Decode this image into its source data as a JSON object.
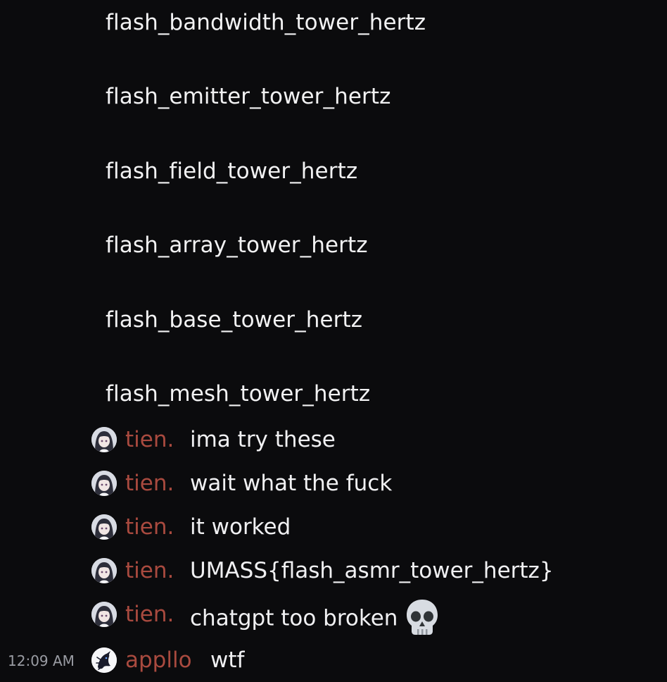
{
  "code_lines": [
    "flash_bandwidth_tower_hertz",
    "flash_emitter_tower_hertz",
    "flash_field_tower_hertz",
    "flash_array_tower_hertz",
    "flash_base_tower_hertz",
    "flash_mesh_tower_hertz"
  ],
  "messages": [
    {
      "author": "tien.",
      "text": "ima try these"
    },
    {
      "author": "tien.",
      "text": "wait what the fuck"
    },
    {
      "author": "tien.",
      "text": "it worked"
    },
    {
      "author": "tien.",
      "text": "UMASS{flash_asmr_tower_hertz}"
    },
    {
      "author": "tien.",
      "text": "chatgpt too broken",
      "emoji": "skull-icon"
    },
    {
      "author": "appllo",
      "text": "wtf",
      "timestamp": "12:09 AM"
    }
  ],
  "colors": {
    "background": "#0b0b0d",
    "author_name": "#a94a3f",
    "message_text": "#f0f0f2",
    "timestamp": "#9a9ca3"
  }
}
